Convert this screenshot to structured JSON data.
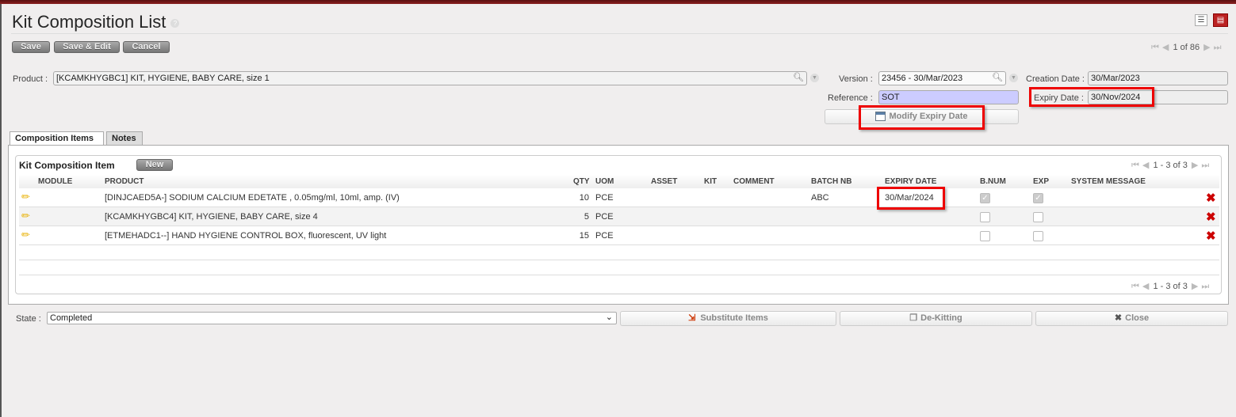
{
  "title": "Kit Composition List",
  "help": "?",
  "toolbar": {
    "save": "Save",
    "save_edit": "Save & Edit",
    "cancel": "Cancel"
  },
  "pager_top": "1 of 86",
  "form": {
    "product_label": "Product :",
    "product_value": "[KCAMKHYGBC1] KIT, HYGIENE, BABY CARE, size 1",
    "version_label": "Version :",
    "version_value": "23456 - 30/Mar/2023",
    "creation_label": "Creation Date :",
    "creation_value": "30/Mar/2023",
    "reference_label": "Reference :",
    "reference_value": "SOT",
    "expiry_label": "Expiry Date :",
    "expiry_value": "30/Nov/2024",
    "modify_expiry": "Modify Expiry Date"
  },
  "tabs": [
    "Composition Items",
    "Notes"
  ],
  "list": {
    "title": "Kit Composition Item",
    "new": "New",
    "pager": "1 - 3 of 3",
    "columns": [
      "MODULE",
      "PRODUCT",
      "QTY",
      "UOM",
      "ASSET",
      "KIT",
      "COMMENT",
      "BATCH NB",
      "EXPIRY DATE",
      "B.NUM",
      "EXP",
      "SYSTEM MESSAGE"
    ],
    "rows": [
      {
        "product": "[DINJCAED5A-] SODIUM CALCIUM EDETATE , 0.05mg/ml, 10ml, amp. (IV)",
        "qty": "10",
        "uom": "PCE",
        "batch": "ABC",
        "expiry": "30/Mar/2024",
        "bnum": true,
        "exp": true
      },
      {
        "product": "[KCAMKHYGBC4] KIT, HYGIENE, BABY CARE, size 4",
        "qty": "5",
        "uom": "PCE",
        "batch": "",
        "expiry": "",
        "bnum": false,
        "exp": false
      },
      {
        "product": "[ETMEHADC1--] HAND HYGIENE CONTROL BOX, fluorescent, UV light",
        "qty": "15",
        "uom": "PCE",
        "batch": "",
        "expiry": "",
        "bnum": false,
        "exp": false
      }
    ]
  },
  "footer": {
    "state_label": "State :",
    "state_value": "Completed",
    "substitute": "Substitute Items",
    "dekitting": "De-Kitting",
    "close": "Close"
  }
}
